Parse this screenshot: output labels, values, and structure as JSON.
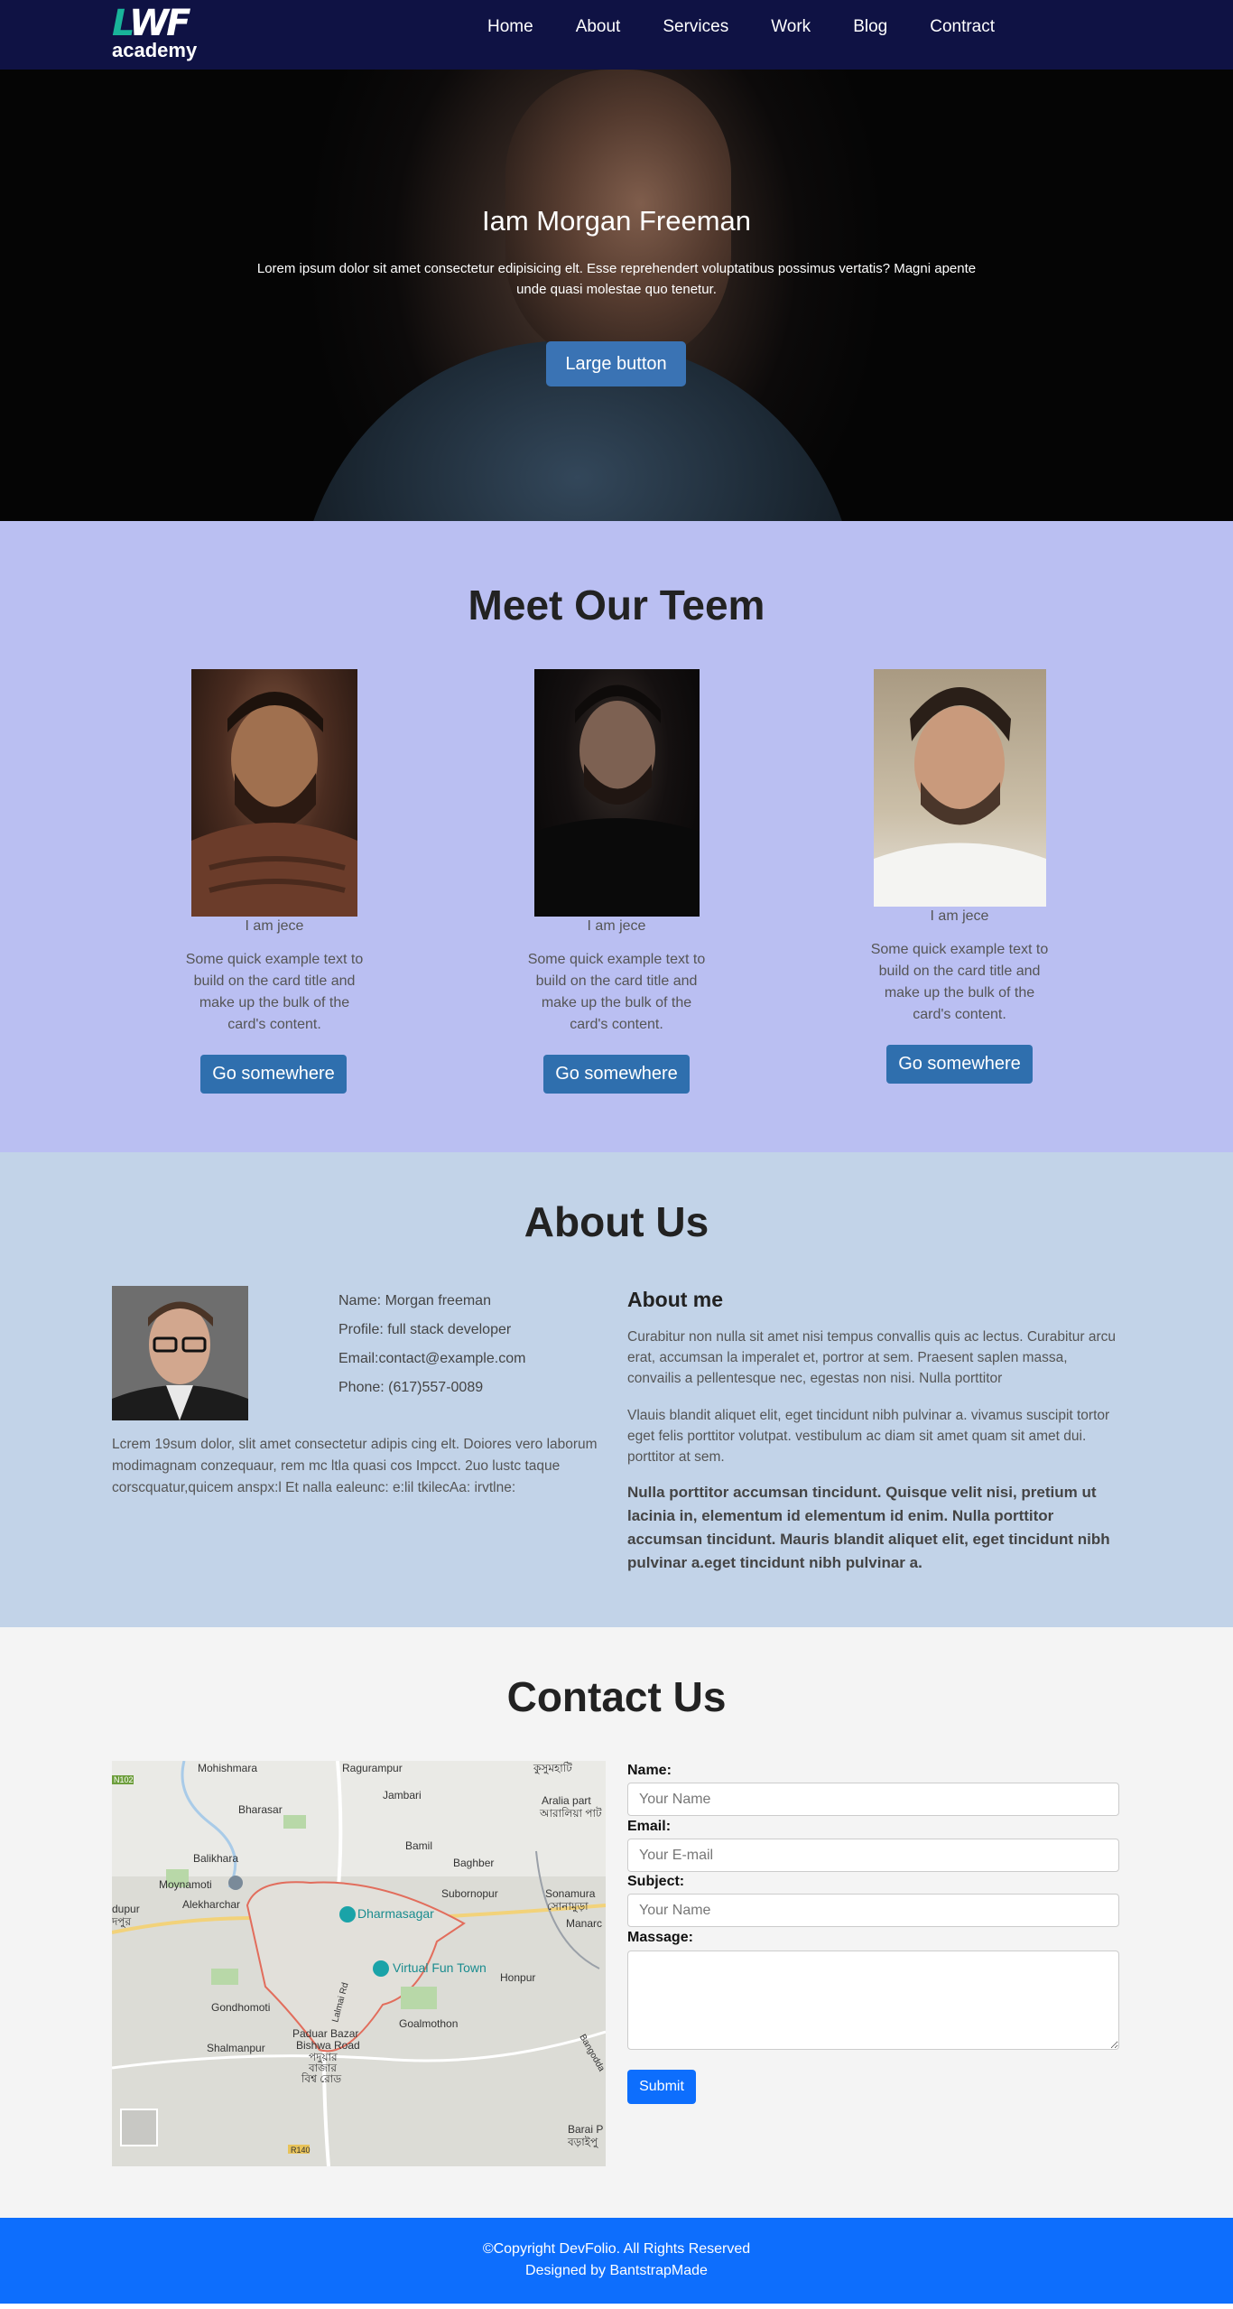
{
  "nav": {
    "logo_mark_a": "L",
    "logo_mark_b": "WF",
    "logo_sub": "academy",
    "items": [
      "Home",
      "About",
      "Services",
      "Work",
      "Blog",
      "Contract"
    ]
  },
  "hero": {
    "title": "Iam Morgan Freeman",
    "text": "Lorem ipsum dolor sit amet consectetur edipisicing elt. Esse reprehendert voluptatibus possimus vertatis? Magni apente unde quasi molestae quo tenetur.",
    "button": "Large button"
  },
  "team": {
    "title": "Meet Our Teem",
    "cards": [
      {
        "name": "I am jece",
        "text": "Some quick example text to build on the card title and make up the bulk of the card's content.",
        "button": "Go somewhere"
      },
      {
        "name": "I am jece",
        "text": "Some quick example text to build on the card title and make up the bulk of the card's content.",
        "button": "Go somewhere"
      },
      {
        "name": "I am jece",
        "text": "Some quick example text to build on the card title and make up the bulk of the card's content.",
        "button": "Go somewhere"
      }
    ]
  },
  "about": {
    "title": "About Us",
    "info": [
      "Name: Morgan freeman",
      "Profile: full stack developer",
      "Email:contact@example.com",
      "Phone: (617)557-0089"
    ],
    "lorem": "Lcrem 19sum dolor, slit amet consectetur adipis cing elt. Doiores vero laborum modimagnam conzequaur, rem mc ltla quasi cos Impcct. 2uo lustc taque corscquatur,quicem anspx:l Et nalla ealeunc: e:lil tkilecAa: irvtlne:",
    "about_me_title": "About me",
    "p1": "Curabitur non nulla sit amet nisi tempus convallis quis ac lectus. Curabitur arcu erat, accumsan la imperalet et, portror at sem. Praesent saplen massa, convailis a pellentesque nec, egestas non nisi. Nulla porttitor",
    "p2": "Vlauis blandit aliquet elit, eget tincidunt nibh pulvinar a. vivamus suscipit tortor eget felis porttitor volutpat. vestibulum ac diam sit amet quam sit amet dui. porttitor at sem.",
    "bold": "Nulla porttitor accumsan tincidunt. Quisque velit nisi, pretium ut lacinia in, elementum id elementum id enim. Nulla porttitor accumsan tincidunt. Mauris blandit aliquet elit, eget tincidunt nibh pulvinar a.eget tincidunt nibh pulvinar a."
  },
  "contact": {
    "title": "Contact Us",
    "map_labels": [
      "Mohishmara",
      "Ragurampur",
      "কুসুমহাটি",
      "Bharasar",
      "Jambari",
      "Aralia part",
      "আরালিয়া পাট",
      "Bamil",
      "Balikhara",
      "Baghber",
      "Moynamoti",
      "Subornopur",
      "Sonamura",
      "সোনামুড়া",
      "Alekharchar",
      "Dharmasagar",
      "Manarc",
      "Virtual Fun Town",
      "Honpur",
      "Gondhomoti",
      "Goalmothon",
      "Paduar Bazar",
      "Bishwa Road",
      "পদুয়ার",
      "বাজার",
      "বিশ্ব রোড",
      "Shalmanpur",
      "Barai P",
      "বড়াইপু",
      "dupur",
      "দপুর",
      "R140",
      "N102",
      "Lalmai Rd",
      "Bangodda"
    ],
    "labels": {
      "name": "Name:",
      "email": "Email:",
      "subject": "Subject:",
      "message": "Massage:"
    },
    "placeholders": {
      "name": "Your Name",
      "email": "Your E-mail",
      "subject": "Your Name"
    },
    "submit": "Submit"
  },
  "footer": {
    "line1": "©Copyright DevFolio. All Rights Reserved",
    "line2": "Designed by BantstrapMade"
  },
  "colors": {
    "nav": "#0f1244",
    "team_bg": "#babff2",
    "about_bg": "#c2d3e8",
    "contact_bg": "#f4f4f4",
    "footer": "#0d6efd",
    "card_button": "#2f6fae"
  }
}
